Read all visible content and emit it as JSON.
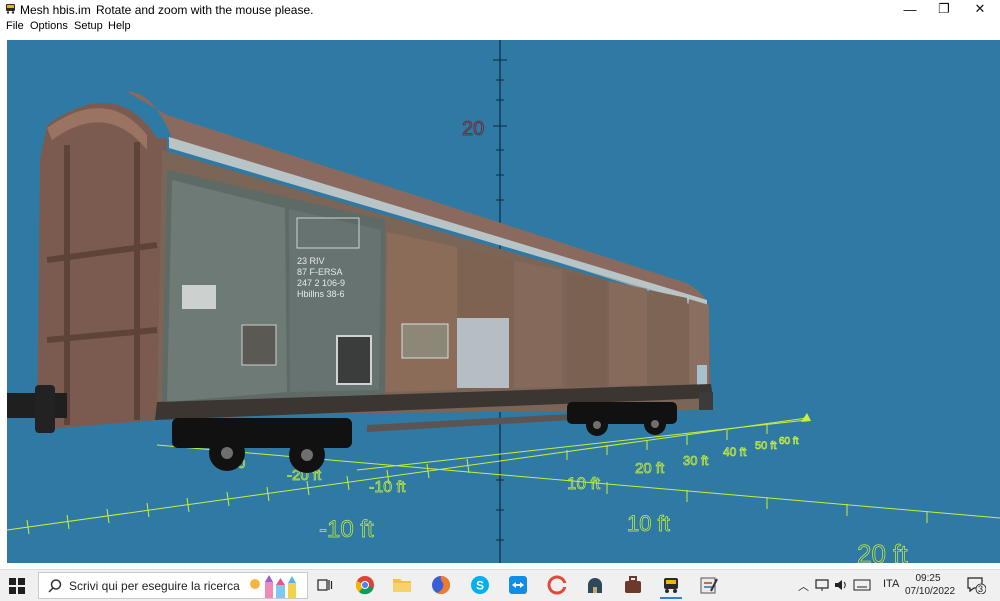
{
  "window": {
    "title": "Mesh hbis.im",
    "hint": "Rotate and zoom with the mouse please.",
    "controls": {
      "minimize": "—",
      "restore": "❐",
      "close": "✕"
    }
  },
  "menu": [
    "File",
    "Options",
    "Setup",
    "Help"
  ],
  "scene": {
    "background_color": "#2f7aa4",
    "grid_color": "#c8ef3a",
    "vertical_axis_label": "20",
    "axis_labels_left": [
      "-30",
      "-20 ft",
      "-10 ft",
      "-10 ft"
    ],
    "axis_labels_right": [
      "10 ft",
      "20 ft",
      "20 ft",
      "30 ft",
      "40 ft",
      "50 ft",
      "60 ft",
      "10 ft",
      "20 ft"
    ],
    "wagon_markings": {
      "line1": "23 RIV",
      "line2": "87 F-ERSA",
      "line3": "247 2 106-9",
      "line4": "Hbillns  38-6"
    }
  },
  "taskbar": {
    "search_placeholder": "Scrivi qui per eseguire la ricerca",
    "apps": [
      "task-view",
      "chrome",
      "file-explorer",
      "firefox",
      "skype",
      "teamviewer",
      "ccleaner",
      "app-dome",
      "app-suitcase",
      "app-train",
      "app-editor"
    ],
    "language": "ITA",
    "time": "09:25",
    "date": "07/10/2022",
    "notifications": "3"
  }
}
